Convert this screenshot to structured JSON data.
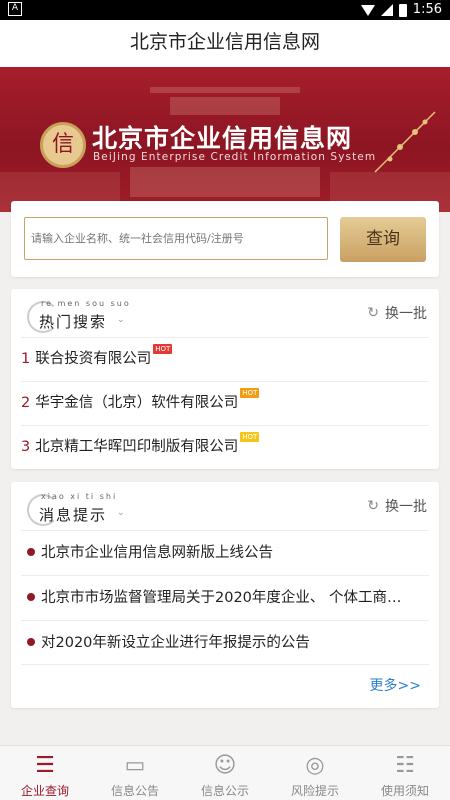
{
  "status_bar": {
    "time": "1:56"
  },
  "title": "北京市企业信用信息网",
  "banner": {
    "seal_char": "信",
    "title": "北京市企业信用信息网",
    "subtitle": "BeiJing Enterprise Credit Information System"
  },
  "search": {
    "placeholder": "请输入企业名称、统一社会信用代码/注册号",
    "button_label": "查询"
  },
  "hot_search": {
    "pinyin": "re men sou suo",
    "title": "热门搜索",
    "refresh_label": "换一批",
    "items": [
      {
        "rank": "1",
        "name": "联合投资有限公司",
        "badge": "HOT",
        "badge_color": "#e53935"
      },
      {
        "rank": "2",
        "name": "华宇金信（北京）软件有限公司",
        "badge": "HOT",
        "badge_color": "#f39c12"
      },
      {
        "rank": "3",
        "name": "北京精工华晖凹印制版有限公司",
        "badge": "HOT",
        "badge_color": "#f5c518"
      }
    ]
  },
  "messages": {
    "pinyin": "xiao xi ti shi",
    "title": "消息提示",
    "refresh_label": "换一批",
    "items": [
      "北京市企业信用信息网新版上线公告",
      "北京市市场监督管理局关于2020年度企业、 个体工商…",
      "对2020年新设立企业进行年报提示的公告"
    ],
    "more_label": "更多>>"
  },
  "tabs": [
    {
      "label": "企业查询",
      "icon": "search-list-icon",
      "active": true
    },
    {
      "label": "信息公告",
      "icon": "bus-stop-icon",
      "active": false
    },
    {
      "label": "信息公示",
      "icon": "badge-icon",
      "active": false
    },
    {
      "label": "风险提示",
      "icon": "bulb-icon",
      "active": false
    },
    {
      "label": "使用须知",
      "icon": "notice-icon",
      "active": false
    }
  ],
  "colors": {
    "brand_red": "#9a1a2a",
    "gold": "#c9a063",
    "link_blue": "#2c7fd0"
  }
}
